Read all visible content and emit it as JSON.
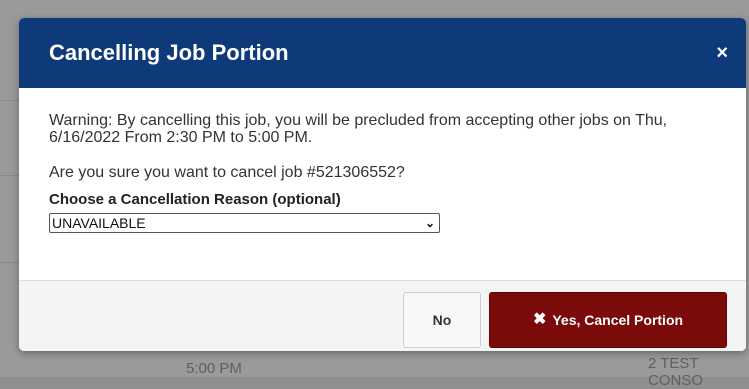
{
  "modal": {
    "title": "Cancelling Job Portion",
    "close_icon": "×",
    "warning": "Warning: By cancelling this job, you will be precluded from accepting other jobs on Thu, 6/16/2022 From 2:30 PM to 5:00 PM.",
    "question": "Are you sure you want to cancel job #521306552?",
    "reason_label": "Choose a Cancellation Reason (optional)",
    "reason_selected": "UNAVAILABLE",
    "no_label": "No",
    "yes_icon": "✖",
    "yes_label": "Yes, Cancel Portion"
  },
  "background": {
    "time_fragment": "5:00 PM",
    "right_fragment": "2 TEST CONSO"
  },
  "colors": {
    "header": "#0e3a7a",
    "danger_button": "#7b0a0a",
    "overlay": "#9a9a9a"
  }
}
